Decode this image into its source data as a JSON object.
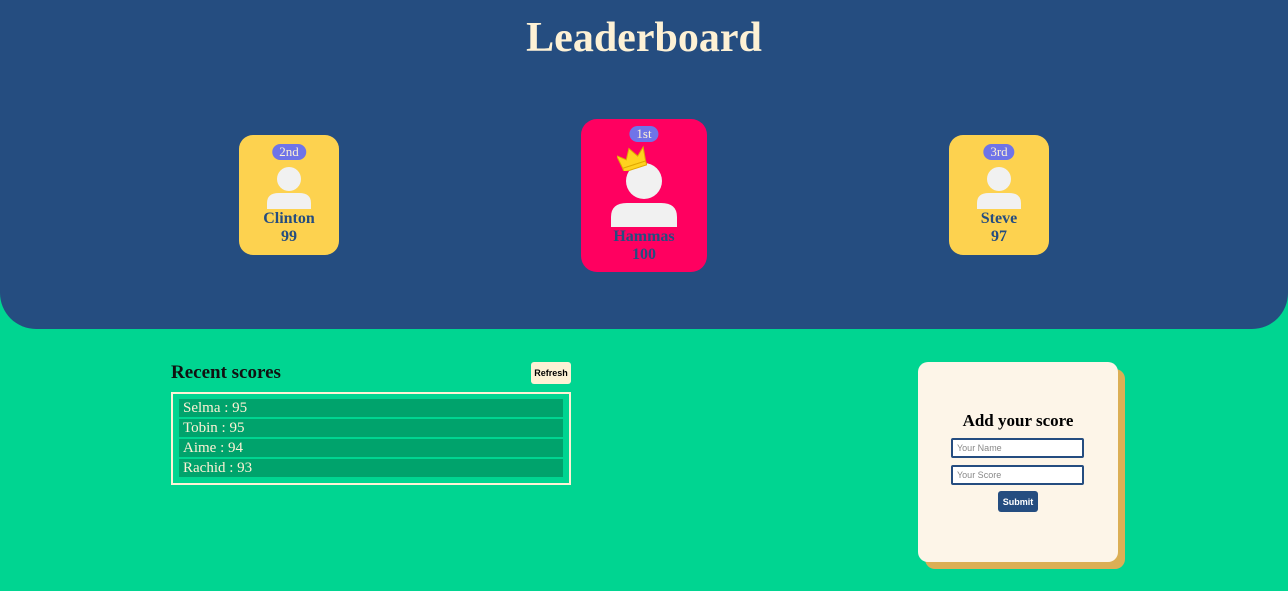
{
  "header": {
    "title": "Leaderboard"
  },
  "podium": {
    "first": {
      "rank": "1st",
      "name": "Hammas",
      "score": "100"
    },
    "second": {
      "rank": "2nd",
      "name": "Clinton",
      "score": "99"
    },
    "third": {
      "rank": "3rd",
      "name": "Steve",
      "score": "97"
    }
  },
  "recent": {
    "title": "Recent scores",
    "refresh_label": "Refresh",
    "rows": [
      "Selma : 95",
      "Tobin : 95",
      "Aime : 94",
      "Rachid : 93"
    ]
  },
  "form": {
    "title": "Add your score",
    "name_placeholder": "Your Name",
    "score_placeholder": "Your Score",
    "submit_label": "Submit"
  },
  "colors": {
    "background": "#00d591",
    "header": "#254d80",
    "first_card": "#ff0060",
    "runner_card": "#fdd24f",
    "rank_badge": "#6f74e8",
    "cream": "#fdf1d5"
  },
  "icons": {
    "avatar": "user-avatar-icon",
    "crown": "crown-icon"
  }
}
